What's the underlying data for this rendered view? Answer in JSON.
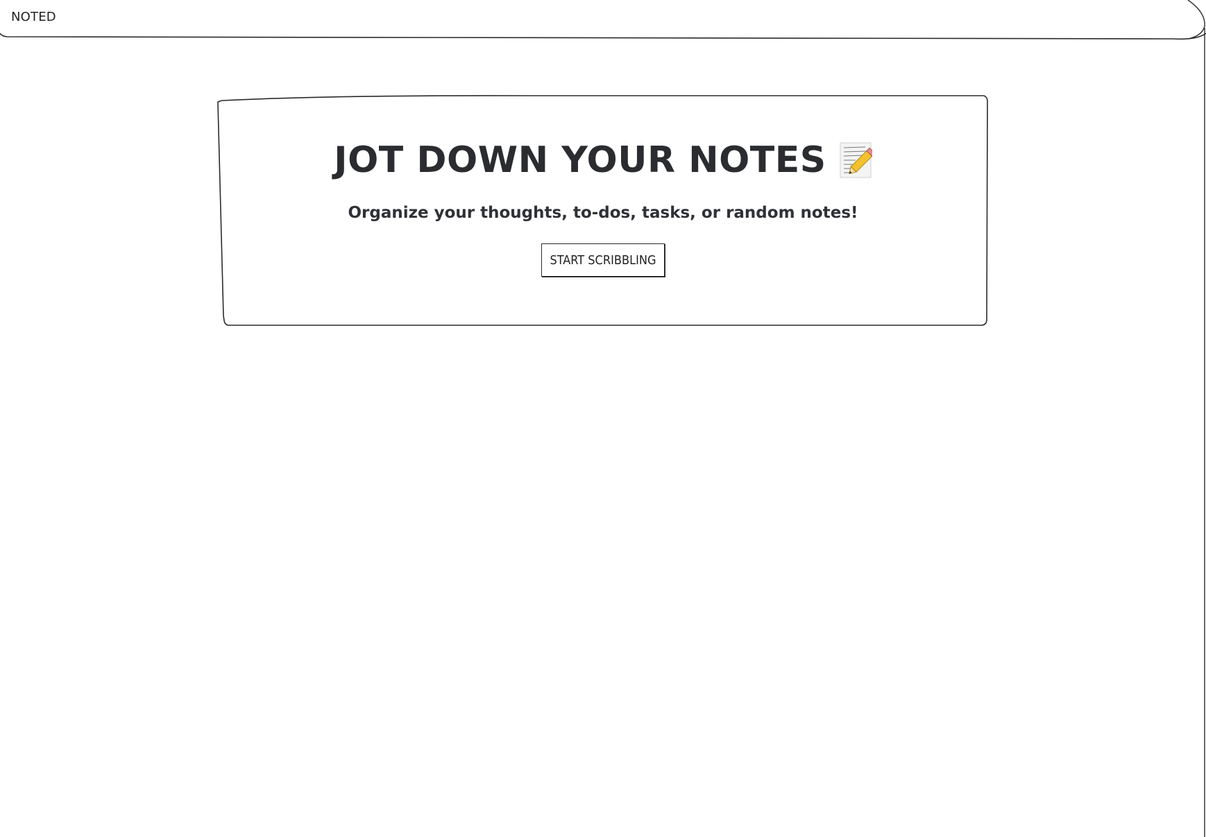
{
  "header": {
    "brand": "NOTED"
  },
  "hero": {
    "title": "JOT DOWN YOUR NOTES",
    "icon": "memo-icon",
    "subtitle": "Organize your thoughts, to-dos, tasks, or random notes!",
    "cta_label": "START SCRIBBLING"
  },
  "colors": {
    "ink": "#2b2b2b",
    "background": "#ffffff",
    "pencil_yellow": "#f2c230",
    "pencil_eraser": "#e58a8a"
  }
}
